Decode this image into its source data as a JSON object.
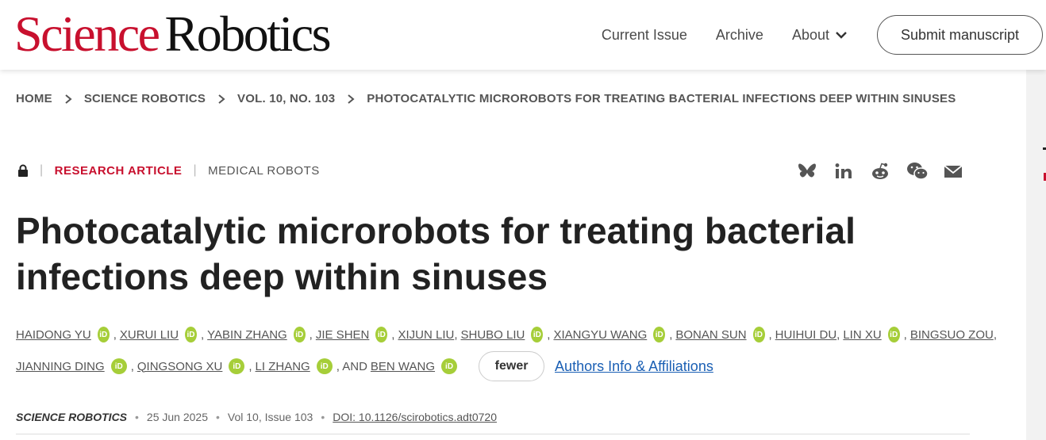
{
  "logo": {
    "science": "Science",
    "robotics": "Robotics"
  },
  "nav": {
    "current_issue": "Current Issue",
    "archive": "Archive",
    "about": "About",
    "submit": "Submit manuscript"
  },
  "breadcrumb": [
    "HOME",
    "SCIENCE ROBOTICS",
    "VOL. 10, NO. 103",
    "PHOTOCATALYTIC MICROROBOTS FOR TREATING BACTERIAL INFECTIONS DEEP WITHIN SINUSES"
  ],
  "article": {
    "type": "RESEARCH ARTICLE",
    "subject": "MEDICAL ROBOTS",
    "title": "Photocatalytic microrobots for treating bacterial infections deep within sinuses"
  },
  "share_icons": [
    "bluesky-icon",
    "linkedin-icon",
    "reddit-icon",
    "wechat-icon",
    "email-icon"
  ],
  "authors": {
    "names": [
      "HAIDONG YU",
      "XURUI LIU",
      "YABIN ZHANG",
      "JIE SHEN",
      "XIJUN LIU",
      "SHUBO LIU",
      "XIANGYU WANG",
      "BONAN SUN",
      "HUIHUI DU",
      "LIN XU",
      "BINGSUO ZOU",
      "JIANNING DING",
      "QINGSONG XU",
      "LI ZHANG",
      "BEN WANG"
    ],
    "orcid_badge": "iD",
    "comma": ",",
    "and": ", AND",
    "fewer_label": "fewer",
    "affiliations_link": "Authors Info & Affiliations"
  },
  "citation": {
    "journal": "SCIENCE ROBOTICS",
    "date": "25 Jun 2025",
    "issue": "Vol 10, Issue 103",
    "doi": "DOI: 10.1126/scirobotics.adt0720",
    "separator": "•"
  },
  "colors": {
    "brand_red": "#c8102e",
    "orcid_green": "#a6ce39",
    "link_blue": "#1a5fb4"
  }
}
